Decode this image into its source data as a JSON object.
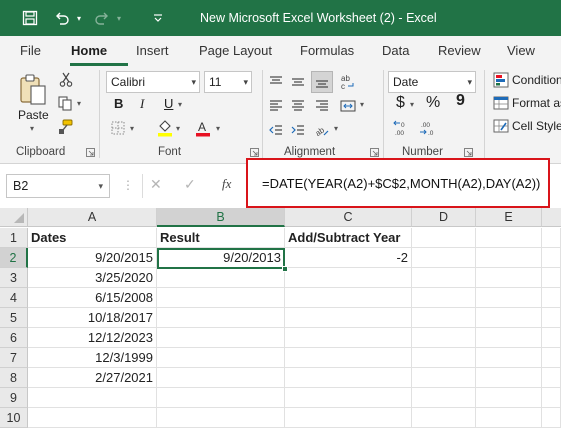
{
  "window": {
    "title": "New Microsoft Excel Worksheet (2)  -  Excel"
  },
  "tabs": [
    "File",
    "Home",
    "Insert",
    "Page Layout",
    "Formulas",
    "Data",
    "Review",
    "View"
  ],
  "active_tab": "Home",
  "ribbon": {
    "clipboard": {
      "label": "Clipboard",
      "paste_label": "Paste"
    },
    "font": {
      "label": "Font",
      "font_name": "Calibri",
      "font_size": "11",
      "bold": "B",
      "italic": "I",
      "underline": "U"
    },
    "alignment": {
      "label": "Alignment"
    },
    "number": {
      "label": "Number",
      "format": "Date",
      "currency": "$",
      "percent": "%",
      "comma": "9"
    },
    "styles": {
      "conditional": "Condition",
      "format_as": "Format as",
      "cell_styles": "Cell Style"
    }
  },
  "formula_bar": {
    "name_box": "B2",
    "fx": "fx",
    "formula": "=DATE(YEAR(A2)+$C$2,MONTH(A2),DAY(A2))"
  },
  "grid": {
    "columns": [
      "A",
      "B",
      "C",
      "D",
      "E"
    ],
    "rows": [
      "1",
      "2",
      "3",
      "4",
      "5",
      "6",
      "7",
      "8",
      "9",
      "10"
    ],
    "header": {
      "a": "Dates",
      "b": "Result",
      "c": "Add/Subtract Year"
    },
    "dates": [
      "9/20/2015",
      "3/25/2020",
      "6/15/2008",
      "10/18/2017",
      "12/12/2023",
      "12/3/1999",
      "2/27/2021"
    ],
    "result_b2": "9/20/2013",
    "value_c2": "-2"
  },
  "colors": {
    "excel_green": "#217346",
    "highlight_red": "#d9141a",
    "font_color_red": "#e81123",
    "fill_yellow": "#ffff00"
  }
}
